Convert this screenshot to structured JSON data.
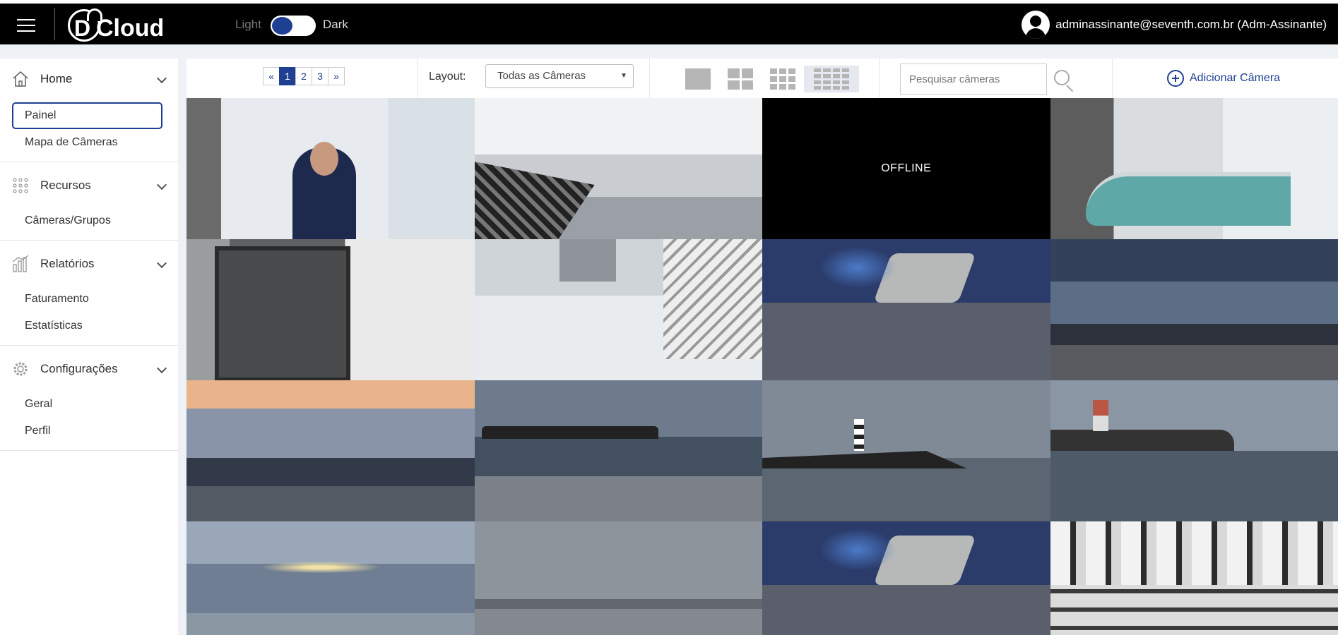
{
  "topbar": {
    "brand": "Cloud",
    "brand_letter": "D",
    "theme_light": "Light",
    "theme_dark": "Dark",
    "user": "adminassinante@seventh.com.br (Adm-Assinante)"
  },
  "sidebar": {
    "home": "Home",
    "painel": "Painel",
    "mapa": "Mapa de Câmeras",
    "recursos": "Recursos",
    "cameras_grupos": "Câmeras/Grupos",
    "relatorios": "Relatórios",
    "faturamento": "Faturamento",
    "estatisticas": "Estatísticas",
    "configuracoes": "Configurações",
    "geral": "Geral",
    "perfil": "Perfil"
  },
  "toolbar": {
    "pager": [
      "«",
      "1",
      "2",
      "3",
      "»"
    ],
    "layout_label": "Layout:",
    "layout_value": "Todas as Câmeras",
    "search_placeholder": "Pesquisar câmeras",
    "add_camera": "Adicionar Câmera"
  },
  "cameras": {
    "c3_status": "OFFLINE"
  },
  "colors": {
    "accent": "#1f3f93",
    "topbar": "#000000"
  }
}
